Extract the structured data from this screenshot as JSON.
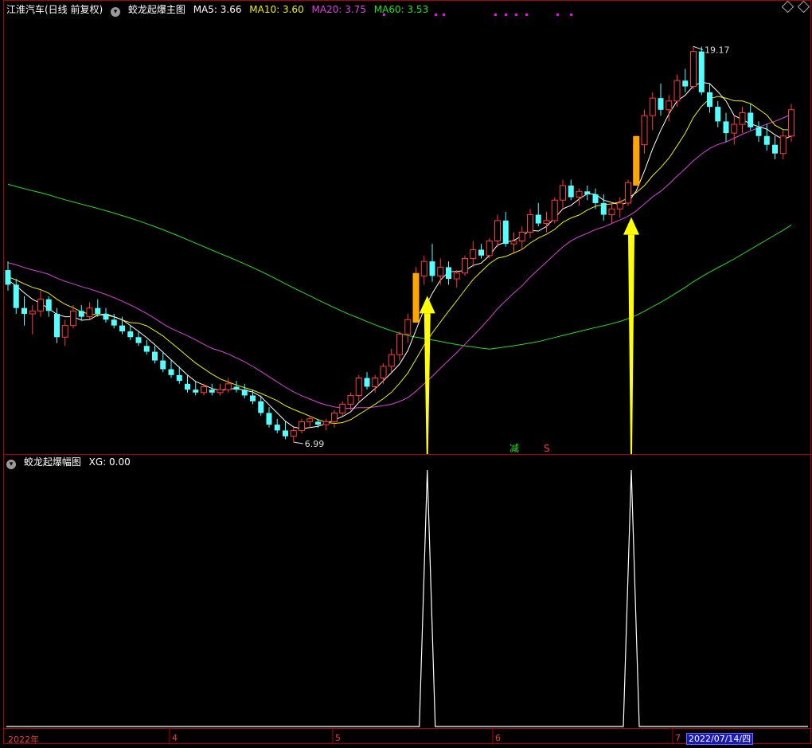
{
  "main_panel": {
    "stock_name": "江淮汽车(日线 前复权)",
    "indicator_name": "蛟龙起爆主图",
    "ma_legend": [
      {
        "label": "MA5: 3.66",
        "color": "#ffffff"
      },
      {
        "label": "MA10: 3.60",
        "color": "#f0f000"
      },
      {
        "label": "MA20: 3.75",
        "color": "#e040e0"
      },
      {
        "label": "MA60: 3.53",
        "color": "#20e020"
      }
    ],
    "high_label": "19.17",
    "low_label": "6.99",
    "signal_jian": "减",
    "signal_s": "S"
  },
  "sub_panel": {
    "indicator_name": "蛟龙起爆幅图",
    "value_label": "XG: 0.00"
  },
  "x_axis": {
    "labels": [
      "2022年",
      "4",
      "5",
      "6",
      "7"
    ],
    "cursor_date": "2022/07/14/四"
  },
  "colors": {
    "up": "#ff3a3a",
    "down": "#54ffff",
    "ma5": "#ffffff",
    "ma10": "#f0f000",
    "ma20": "#e040e0",
    "ma60": "#20e020",
    "signal_bar": "#ffa500",
    "arrow": "#ffff00",
    "axis": "#b00000"
  },
  "icons": [
    "dropdown-icon",
    "diamond-icon",
    "up-arrow-icon"
  ],
  "chart_data": [
    {
      "type": "candlestick",
      "title": "蛟龙起爆主图",
      "series": [
        {
          "name": "MA5",
          "current": 3.66
        },
        {
          "name": "MA10",
          "current": 3.6
        },
        {
          "name": "MA20",
          "current": 3.75
        },
        {
          "name": "MA60",
          "current": 3.53
        }
      ],
      "ohlc": [
        [
          11.5,
          11.8,
          10.8,
          11.0
        ],
        [
          11.0,
          11.2,
          10.0,
          10.2
        ],
        [
          10.2,
          10.6,
          9.6,
          10.0
        ],
        [
          10.0,
          10.3,
          9.3,
          10.1
        ],
        [
          10.1,
          10.8,
          9.9,
          10.5
        ],
        [
          10.5,
          10.6,
          9.9,
          10.1
        ],
        [
          10.0,
          10.2,
          9.0,
          9.2
        ],
        [
          9.2,
          9.8,
          8.9,
          9.6
        ],
        [
          9.6,
          10.3,
          9.5,
          10.1
        ],
        [
          10.1,
          10.3,
          9.8,
          9.9
        ],
        [
          9.9,
          10.4,
          9.8,
          10.2
        ],
        [
          10.2,
          10.5,
          9.9,
          10.0
        ],
        [
          10.0,
          10.2,
          9.7,
          9.8
        ],
        [
          9.8,
          10.0,
          9.5,
          9.6
        ],
        [
          9.6,
          9.9,
          9.3,
          9.4
        ],
        [
          9.4,
          9.6,
          9.1,
          9.2
        ],
        [
          9.2,
          9.4,
          8.9,
          9.0
        ],
        [
          8.9,
          9.1,
          8.6,
          8.7
        ],
        [
          8.7,
          8.9,
          8.3,
          8.4
        ],
        [
          8.4,
          8.7,
          8.0,
          8.1
        ],
        [
          8.1,
          8.4,
          7.8,
          7.9
        ],
        [
          7.9,
          8.2,
          7.6,
          7.7
        ],
        [
          7.6,
          7.9,
          7.3,
          7.4
        ],
        [
          7.4,
          7.7,
          7.2,
          7.3
        ],
        [
          7.3,
          7.6,
          7.2,
          7.5
        ],
        [
          7.4,
          7.6,
          7.2,
          7.3
        ],
        [
          7.3,
          7.6,
          7.2,
          7.4
        ],
        [
          7.4,
          7.8,
          7.3,
          7.6
        ],
        [
          7.5,
          7.7,
          7.3,
          7.4
        ],
        [
          7.4,
          7.6,
          7.1,
          7.2
        ],
        [
          7.2,
          7.4,
          6.9,
          7.0
        ],
        [
          7.0,
          7.2,
          6.5,
          6.6
        ],
        [
          6.6,
          6.8,
          6.1,
          6.2
        ],
        [
          6.2,
          6.4,
          5.9,
          6.0
        ],
        [
          6.0,
          6.3,
          5.7,
          5.8
        ],
        [
          5.8,
          6.1,
          5.6,
          6.0
        ],
        [
          6.0,
          6.4,
          5.9,
          6.3
        ],
        [
          6.3,
          6.5,
          6.1,
          6.4
        ],
        [
          6.3,
          6.4,
          6.1,
          6.2
        ],
        [
          6.2,
          6.4,
          6.0,
          6.3
        ],
        [
          6.3,
          6.7,
          6.1,
          6.6
        ],
        [
          6.6,
          7.0,
          6.5,
          6.9
        ],
        [
          6.9,
          7.3,
          6.7,
          7.2
        ],
        [
          7.2,
          7.9,
          7.0,
          7.8
        ],
        [
          7.8,
          8.0,
          7.4,
          7.5
        ],
        [
          7.5,
          7.9,
          7.3,
          7.8
        ],
        [
          7.8,
          8.3,
          7.6,
          8.2
        ],
        [
          8.2,
          8.8,
          8.0,
          8.6
        ],
        [
          8.6,
          9.4,
          8.4,
          9.3
        ],
        [
          9.3,
          10.0,
          9.0,
          9.8
        ],
        [
          9.8,
          11.6,
          9.7,
          11.3
        ],
        [
          11.3,
          12.0,
          11.0,
          11.8
        ],
        [
          11.8,
          12.4,
          11.1,
          11.3
        ],
        [
          11.3,
          11.9,
          11.0,
          11.6
        ],
        [
          11.6,
          11.8,
          11.0,
          11.2
        ],
        [
          11.2,
          11.5,
          10.9,
          11.4
        ],
        [
          11.4,
          12.0,
          11.3,
          11.9
        ],
        [
          11.9,
          12.5,
          11.6,
          12.2
        ],
        [
          12.2,
          12.4,
          11.9,
          12.0
        ],
        [
          12.0,
          12.6,
          11.9,
          12.5
        ],
        [
          12.5,
          13.4,
          12.3,
          13.2
        ],
        [
          13.2,
          13.5,
          12.3,
          12.4
        ],
        [
          12.4,
          12.8,
          12.1,
          12.5
        ],
        [
          12.5,
          13.0,
          12.2,
          12.8
        ],
        [
          12.8,
          13.6,
          12.6,
          13.4
        ],
        [
          13.4,
          13.8,
          13.0,
          13.1
        ],
        [
          13.1,
          13.5,
          12.8,
          13.2
        ],
        [
          13.2,
          14.0,
          13.1,
          13.9
        ],
        [
          13.9,
          14.6,
          13.6,
          14.4
        ],
        [
          14.4,
          14.6,
          13.9,
          14.0
        ],
        [
          14.0,
          14.3,
          13.7,
          14.2
        ],
        [
          14.2,
          14.4,
          13.9,
          14.1
        ],
        [
          14.1,
          14.3,
          13.6,
          13.8
        ],
        [
          13.8,
          14.1,
          13.2,
          13.4
        ],
        [
          13.4,
          13.8,
          13.1,
          13.6
        ],
        [
          13.6,
          14.0,
          13.3,
          13.8
        ],
        [
          13.8,
          14.6,
          13.7,
          14.5
        ],
        [
          14.5,
          16.0,
          14.4,
          15.8
        ],
        [
          15.8,
          17.0,
          15.5,
          16.8
        ],
        [
          16.8,
          17.6,
          16.3,
          17.4
        ],
        [
          17.4,
          17.9,
          16.8,
          17.0
        ],
        [
          17.0,
          17.5,
          16.6,
          17.3
        ],
        [
          17.3,
          18.2,
          17.1,
          18.0
        ],
        [
          18.0,
          18.4,
          17.6,
          17.8
        ],
        [
          17.8,
          19.17,
          17.7,
          19.0
        ],
        [
          19.0,
          19.17,
          17.5,
          17.6
        ],
        [
          17.6,
          17.9,
          16.9,
          17.1
        ],
        [
          17.1,
          17.3,
          16.4,
          16.6
        ],
        [
          16.6,
          16.9,
          15.9,
          16.2
        ],
        [
          16.2,
          16.8,
          15.8,
          16.5
        ],
        [
          16.5,
          17.1,
          16.2,
          16.9
        ],
        [
          16.9,
          17.2,
          16.3,
          16.4
        ],
        [
          16.4,
          16.6,
          15.9,
          16.1
        ],
        [
          16.1,
          16.5,
          15.6,
          15.8
        ],
        [
          15.8,
          16.1,
          15.3,
          15.5
        ],
        [
          15.5,
          16.3,
          15.3,
          16.1
        ],
        [
          16.1,
          17.2,
          15.9,
          17.0
        ]
      ],
      "price_high": 19.17,
      "price_low": 6.99,
      "signal_bar_indices": [
        50,
        77
      ],
      "arrow_indices": [
        51,
        76
      ]
    },
    {
      "type": "line",
      "title": "蛟龙起爆幅图",
      "series": [
        {
          "name": "XG",
          "current": 0.0,
          "spikes_at_indices": [
            51,
            76
          ],
          "spike_value": 1
        }
      ],
      "ylim": [
        0,
        1
      ]
    }
  ]
}
